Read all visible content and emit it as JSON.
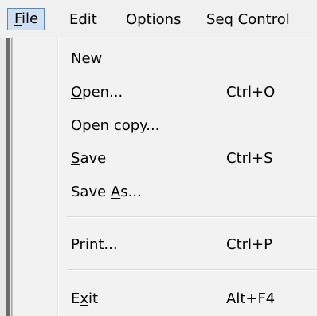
{
  "menubar": {
    "file": {
      "pre": "",
      "key": "F",
      "post": "ile"
    },
    "edit": {
      "pre": "",
      "key": "E",
      "post": "dit"
    },
    "options": {
      "pre": "",
      "key": "O",
      "post": "ptions"
    },
    "seq": {
      "pre": "",
      "key": "S",
      "post": "eq Control"
    }
  },
  "file_menu": {
    "new": {
      "pre": "",
      "key": "N",
      "post": "ew",
      "shortcut": ""
    },
    "open": {
      "pre": "",
      "key": "O",
      "post": "pen...",
      "shortcut": "Ctrl+O"
    },
    "open_copy": {
      "pre": "Open ",
      "key": "c",
      "post": "opy...",
      "shortcut": ""
    },
    "save": {
      "pre": "",
      "key": "S",
      "post": "ave",
      "shortcut": "Ctrl+S"
    },
    "save_as": {
      "pre": "Save ",
      "key": "A",
      "post": "s...",
      "shortcut": ""
    },
    "print": {
      "pre": "",
      "key": "P",
      "post": "rint...",
      "shortcut": "Ctrl+P"
    },
    "exit": {
      "pre": "E",
      "key": "x",
      "post": "it",
      "shortcut": "Alt+F4"
    }
  }
}
